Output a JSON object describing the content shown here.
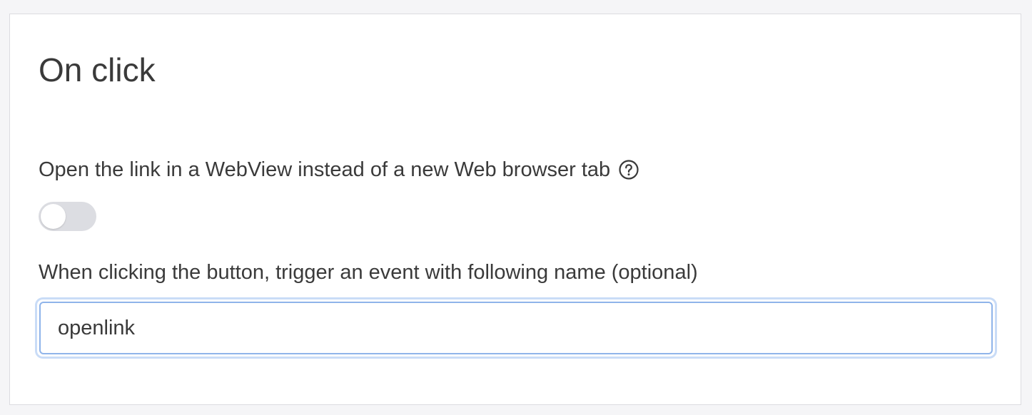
{
  "section": {
    "title": "On click"
  },
  "webview": {
    "label": "Open the link in a WebView instead of a new Web browser tab",
    "help_icon": "question-circle-icon",
    "toggle_on": false
  },
  "event": {
    "label": "When clicking the button, trigger an event with following name (optional)",
    "value": "openlink"
  },
  "colors": {
    "toggle_off": "#dcdde2",
    "input_focus_border": "#8fb4ea",
    "input_focus_ring": "#c9dcf7",
    "text": "#3a3a3a"
  }
}
